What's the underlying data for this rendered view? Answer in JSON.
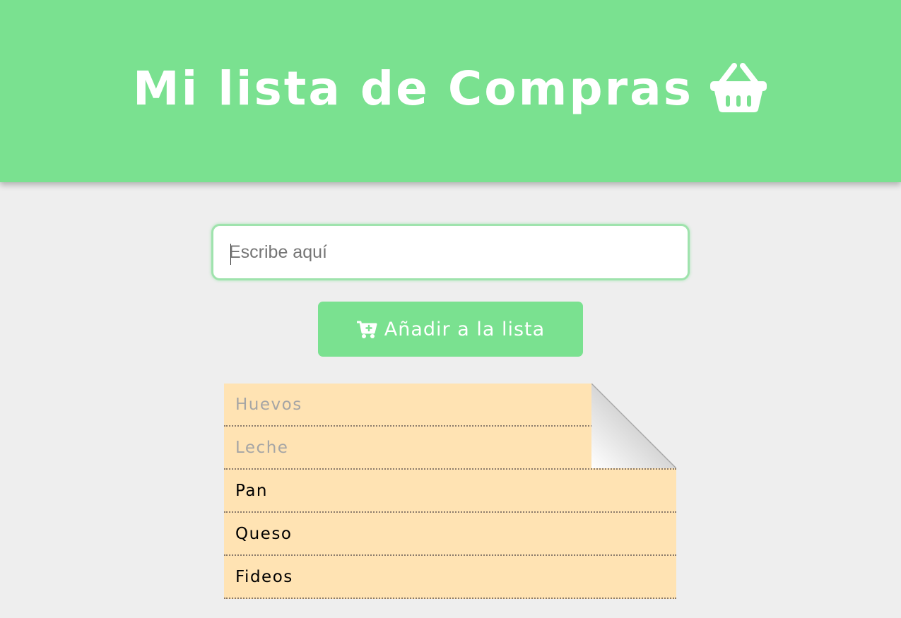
{
  "header": {
    "title": "Mi lista de Compras",
    "icon": "shopping-basket-icon",
    "background_color": "#7ae190"
  },
  "form": {
    "input_placeholder": "Escribe aquí",
    "input_value": "",
    "button_label": "Añadir a la lista",
    "button_icon": "cart-plus-icon"
  },
  "list": {
    "items": [
      {
        "label": "Huevos",
        "done": true
      },
      {
        "label": "Leche",
        "done": true
      },
      {
        "label": "Pan",
        "done": false
      },
      {
        "label": "Queso",
        "done": false
      },
      {
        "label": "Fideos",
        "done": false
      }
    ],
    "background_color": "#ffe3b3",
    "done_color": "#a5a5a5"
  }
}
